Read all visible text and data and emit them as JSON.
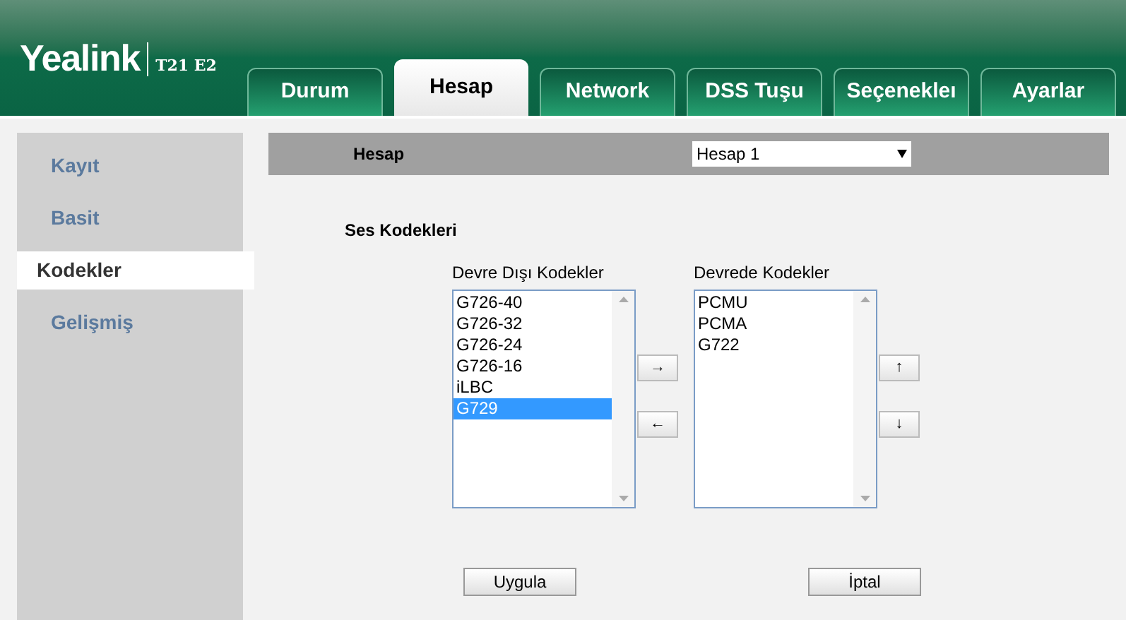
{
  "header": {
    "logo": "Yealink",
    "model": "T21 E2"
  },
  "tabs": [
    {
      "label": "Durum",
      "selected": false
    },
    {
      "label": "Hesap",
      "selected": true
    },
    {
      "label": "Network",
      "selected": false
    },
    {
      "label": "DSS Tuşu",
      "selected": false
    },
    {
      "label": "Seçenekleı",
      "selected": false
    },
    {
      "label": "Ayarlar",
      "selected": false
    }
  ],
  "sidebar": {
    "items": [
      {
        "label": "Kayıt",
        "selected": false
      },
      {
        "label": "Basit",
        "selected": false
      },
      {
        "label": "Kodekler",
        "selected": true
      },
      {
        "label": "Gelişmiş",
        "selected": false
      }
    ]
  },
  "account_bar": {
    "label": "Hesap",
    "select_value": "Hesap 1"
  },
  "section_title": "Ses Kodekleri",
  "disabled_codecs": {
    "label": "Devre Dışı Kodekler",
    "items": [
      {
        "label": "G726-40",
        "selected": false
      },
      {
        "label": "G726-32",
        "selected": false
      },
      {
        "label": "G726-24",
        "selected": false
      },
      {
        "label": "G726-16",
        "selected": false
      },
      {
        "label": "iLBC",
        "selected": false
      },
      {
        "label": "G729",
        "selected": true
      }
    ]
  },
  "move_buttons": [
    "→",
    "←"
  ],
  "enabled_codecs": {
    "label": "Devrede Kodekler",
    "items": [
      {
        "label": "PCMU",
        "selected": false
      },
      {
        "label": "PCMA",
        "selected": false
      },
      {
        "label": "G722",
        "selected": false
      }
    ]
  },
  "order_buttons": [
    "↑",
    "↓"
  ],
  "buttons": [
    "Uygula",
    "İptal"
  ]
}
